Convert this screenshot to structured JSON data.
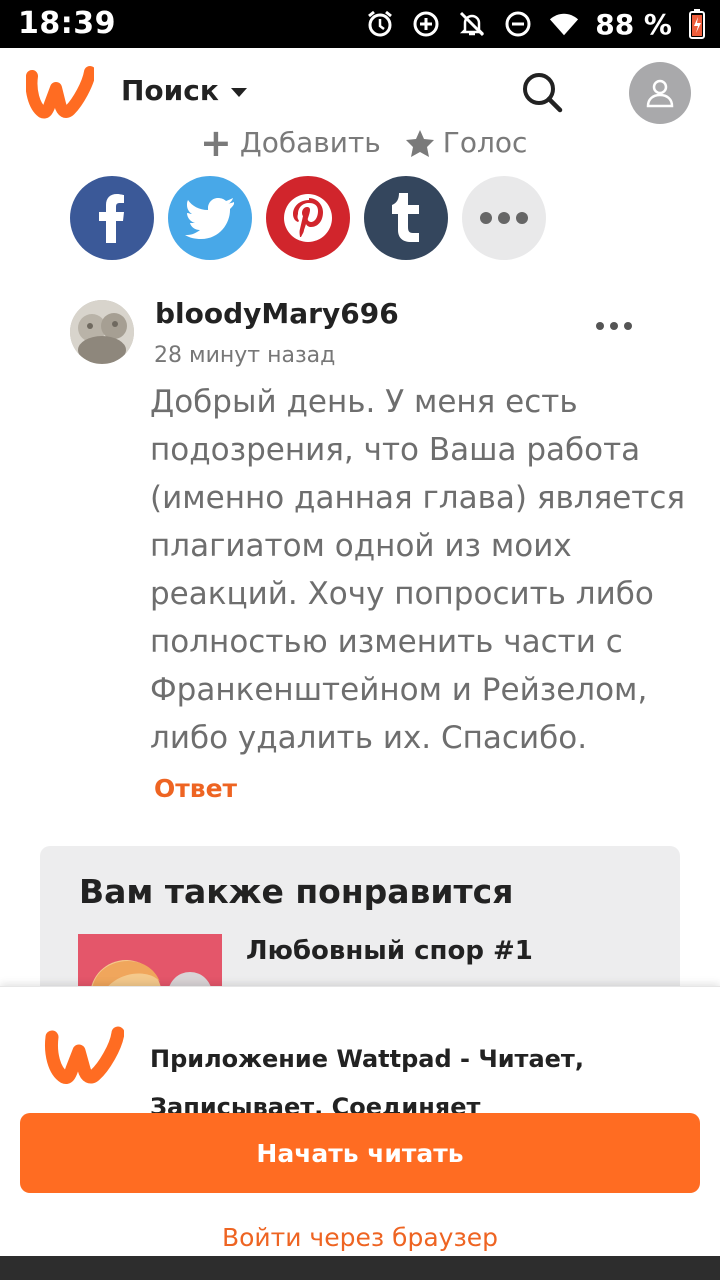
{
  "status_bar": {
    "time": "18:39",
    "battery": "88 %",
    "icons": [
      "alarm-icon",
      "data-saver-icon",
      "notifications-off-icon",
      "do-not-disturb-icon",
      "wifi-icon",
      "battery-icon"
    ]
  },
  "header": {
    "logo": "wattpad-logo",
    "search_label": "Поиск"
  },
  "story_actions": {
    "add_label": "Добавить",
    "vote_label": "Голос"
  },
  "share": [
    "facebook",
    "twitter",
    "pinterest",
    "tumblr",
    "more"
  ],
  "comment": {
    "author": "bloodyMary696",
    "time": "28 минут назад",
    "body": "Добрый день. У меня есть подозрения, что Ваша работа (именно данная глава) является плагиатом одной из моих реакций. Хочу попросить либо полностью изменить части с Франкенштейном и Рейзелом, либо удалить их. Спасибо.",
    "reply_label": "Ответ"
  },
  "recommendations": {
    "title": "Вам также понравится",
    "items": [
      {
        "title": "Любовный спор #1"
      }
    ]
  },
  "app_banner": {
    "text": "Приложение Wattpad - Читает, Записывает, Соединяет",
    "cta_label": "Начать читать",
    "browser_label": "Войти через браузер"
  },
  "colors": {
    "accent": "#ff6c22",
    "link": "#ee6422",
    "facebook": "#3b5998",
    "twitter": "#48a8e8",
    "pinterest": "#d1252c",
    "tumblr": "#34465d"
  }
}
